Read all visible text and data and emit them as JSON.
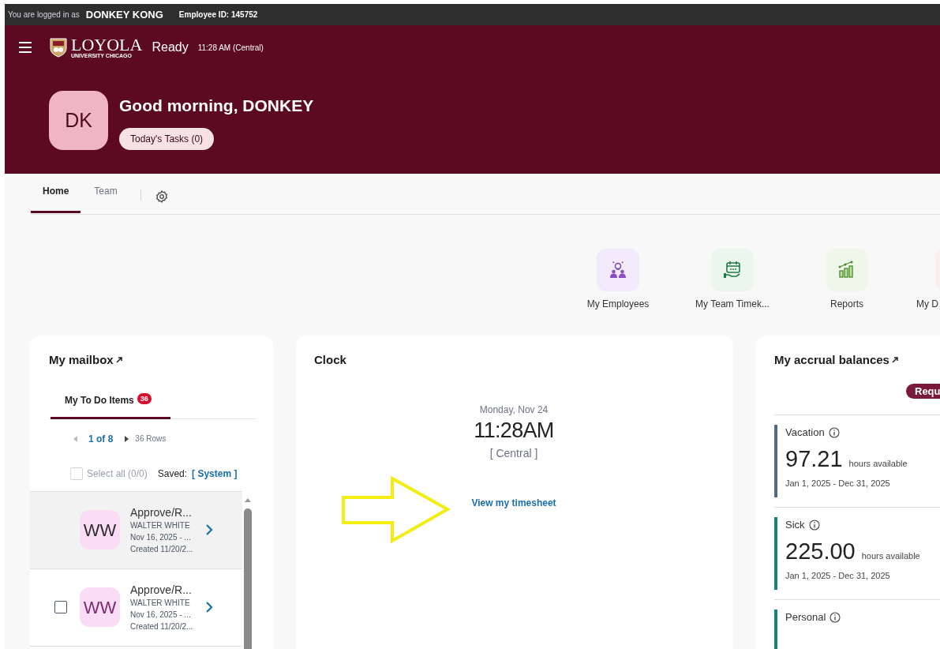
{
  "session_bar": {
    "prefix": "You are logged in as",
    "user": "DONKEY KONG",
    "employee_id": "Employee ID: 145752"
  },
  "header": {
    "logo_name": "LOYOLA",
    "logo_sub": "UNIVERSITY CHICAGO",
    "status": "Ready",
    "time": "11:28 AM (Central)",
    "avatar": "DK",
    "greeting": "Good morning, DONKEY",
    "tasks_button": "Today's Tasks (0)"
  },
  "tabs": [
    {
      "label": "Home",
      "selected": true
    },
    {
      "label": "Team",
      "selected": false
    }
  ],
  "quick_links": [
    {
      "label": "My Employees",
      "kind": "employees"
    },
    {
      "label": "My Team Timek...",
      "kind": "timekeeping"
    },
    {
      "label": "Reports",
      "kind": "reports"
    },
    {
      "label": "My D",
      "kind": "partial"
    }
  ],
  "mailbox": {
    "title": "My mailbox",
    "tab": {
      "label": "My To Do Items",
      "badge": "36",
      "selected": true
    },
    "page": "1 of 8",
    "rows_count": "36 Rows",
    "select_all": {
      "label": "Select all (0/0)",
      "disabled": true
    },
    "saved_label": "Saved:",
    "saved_value": "[ System ]",
    "rows": [
      {
        "initials": "WW",
        "title": "Approve/R...",
        "name": "WALTER WHITE",
        "period": "Nov 16, 2025 - ...",
        "created": "Created 11/20/2...",
        "selected": true,
        "color": "#2d2d2d"
      },
      {
        "initials": "WW",
        "title": "Approve/R...",
        "name": "WALTER WHITE",
        "period": "Nov 16, 2025 - ...",
        "created": "Created 11/20/2...",
        "selected": false,
        "color": "#7a2a6e"
      }
    ]
  },
  "clock": {
    "title": "Clock",
    "date": "Monday, Nov 24",
    "time": "11:28AM",
    "zone": "[ Central ]",
    "link": "View my timesheet"
  },
  "accruals": {
    "title": "My accrual balances",
    "button": "Requ",
    "items": [
      {
        "name": "Vacation",
        "amount": "97.21",
        "unit": "hours available",
        "period": "Jan 1, 2025 - Dec 31, 2025",
        "color": "#4f6a8c"
      },
      {
        "name": "Sick",
        "amount": "225.00",
        "unit": "hours available",
        "period": "Jan 1, 2025 - Dec 31, 2025",
        "color": "#0e8577"
      },
      {
        "name": "Personal",
        "color": "#0e8577"
      }
    ]
  }
}
